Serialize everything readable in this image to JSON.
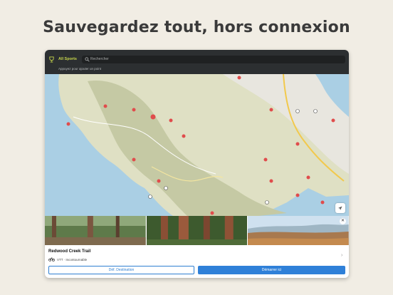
{
  "headline": "Sauvegardez tout, hors connexion",
  "topbar": {
    "sports_label": "All Sports",
    "search_placeholder": "Rechercher",
    "hint": "Appuyez pour ajouter un point"
  },
  "trail": {
    "title": "Redwood Creek Trail",
    "meta": "VTT · Incontournable"
  },
  "actions": {
    "destination_label": "Déf. Destination",
    "start_label": "Démarrer ici"
  },
  "colors": {
    "accent_blue": "#2f80d8",
    "sports_green": "#c7d64b",
    "poi_red": "#e04c4c",
    "water": "#aacfe4",
    "land": "#dfe0c4"
  }
}
